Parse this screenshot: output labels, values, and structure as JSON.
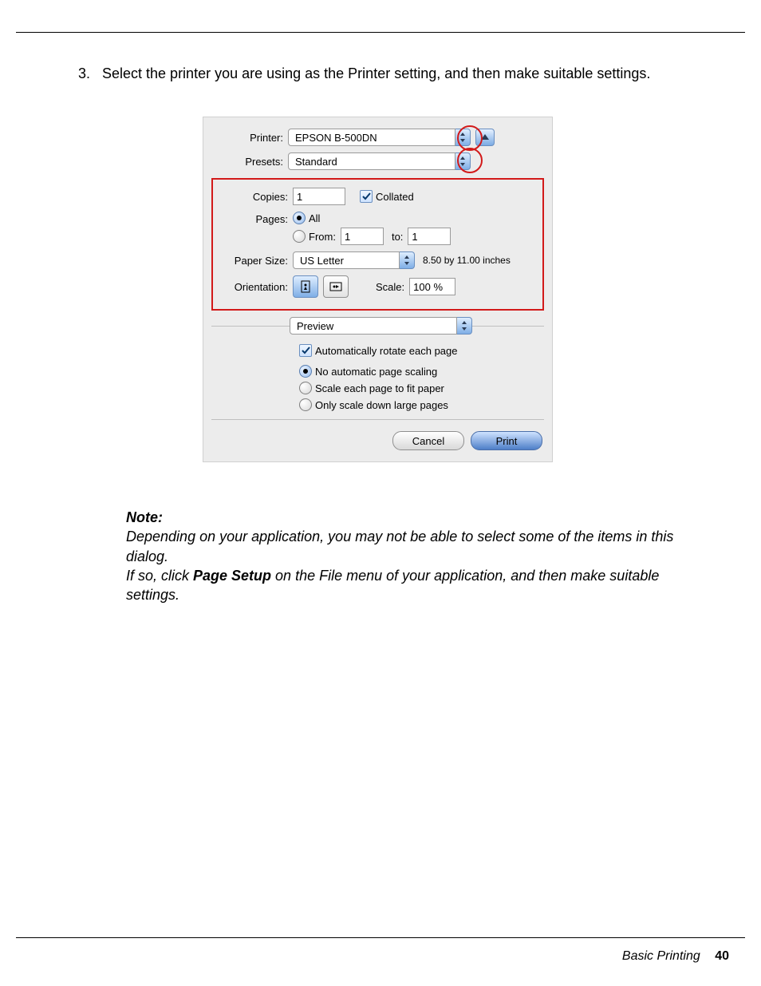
{
  "step": {
    "number": "3.",
    "text": "Select the printer you are using as the Printer setting, and then make suitable settings."
  },
  "dialog": {
    "printer_label": "Printer:",
    "printer_value": "EPSON B-500DN",
    "presets_label": "Presets:",
    "presets_value": "Standard",
    "copies_label": "Copies:",
    "copies_value": "1",
    "collated_label": "Collated",
    "pages_label": "Pages:",
    "pages_all": "All",
    "pages_from_label": "From:",
    "pages_from_value": "1",
    "pages_to_label": "to:",
    "pages_to_value": "1",
    "papersize_label": "Paper Size:",
    "papersize_value": "US Letter",
    "papersize_dims": "8.50 by 11.00 inches",
    "orientation_label": "Orientation:",
    "scale_label": "Scale:",
    "scale_value": "100 %",
    "section_value": "Preview",
    "auto_rotate": "Automatically rotate each page",
    "scaling_none": "No automatic page scaling",
    "scaling_fit": "Scale each page to fit paper",
    "scaling_down": "Only scale down large pages",
    "cancel": "Cancel",
    "print": "Print"
  },
  "note": {
    "heading": "Note:",
    "line1a": "Depending on your application, you may not be able to select some of the items in this dialog.",
    "line2a": "If so, click ",
    "line2b": "Page Setup",
    "line2c": " on the File menu of your application, and then make suitable settings."
  },
  "footer": {
    "section": "Basic Printing",
    "page": "40"
  }
}
